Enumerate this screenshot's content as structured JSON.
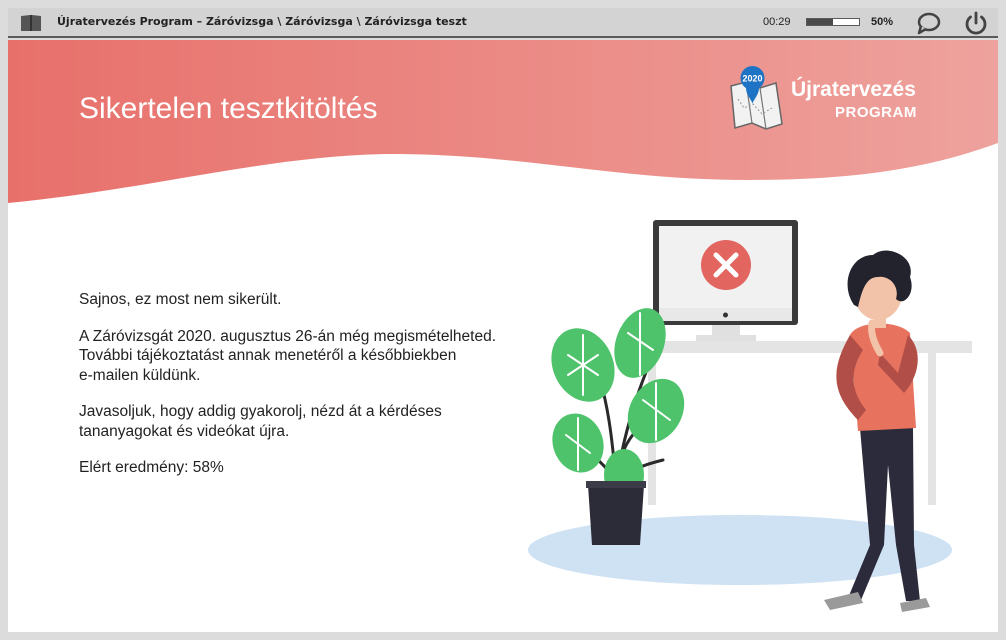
{
  "topbar": {
    "breadcrumb": "Újratervezés Program – Záróvizsga \\ Záróvizsga \\ Záróvizsga teszt",
    "timer": "00:29",
    "progress": 0.5,
    "progress_label": "50%",
    "icons": [
      "book-icon",
      "chat-bubble-icon",
      "power-icon"
    ]
  },
  "header": {
    "title": "Sikertelen tesztkitöltés",
    "gradient_start": "#e8706b",
    "gradient_end": "#eea29d"
  },
  "logo": {
    "pin_text": "2020",
    "word": "Újratervezés",
    "sub": "PROGRAM"
  },
  "body": {
    "line1": "Sajnos, ez most nem sikerült.",
    "para2": [
      "A Záróvizsgát 2020. augusztus 26-án még megismételheted.",
      "További tájékoztatást annak menetéről a későbbiekben",
      "e-mailen küldünk."
    ],
    "para3": [
      "Javasoljuk, hogy addig gyakorolj, nézd át a kérdéses",
      "tananyagokat és videókat újra."
    ],
    "result": "Elért eredmény: 58%"
  },
  "colors": {
    "accent_red": "#e8706b",
    "plant_green": "#4ec36b",
    "shadow_blue": "#cfe2f3"
  }
}
